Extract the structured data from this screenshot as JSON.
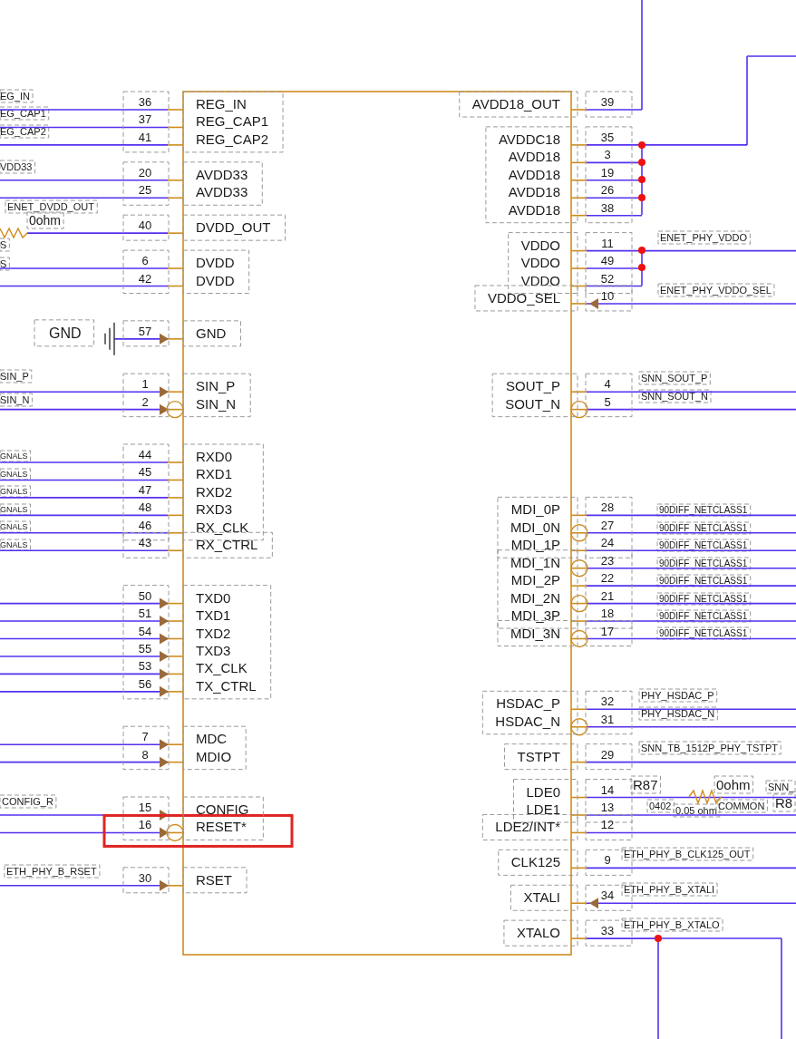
{
  "component": {
    "left_groups": [
      {
        "pins": [
          {
            "number": "36",
            "name": "REG_IN",
            "kind": "line",
            "highlighted": false
          },
          {
            "number": "37",
            "name": "REG_CAP1",
            "kind": "line",
            "highlighted": false
          },
          {
            "number": "41",
            "name": "REG_CAP2",
            "kind": "line",
            "highlighted": false
          }
        ]
      },
      {
        "pins": [
          {
            "number": "20",
            "name": "AVDD33",
            "kind": "line",
            "highlighted": false
          },
          {
            "number": "25",
            "name": "AVDD33",
            "kind": "line",
            "highlighted": false
          }
        ]
      },
      {
        "pins": [
          {
            "number": "40",
            "name": "DVDD_OUT",
            "kind": "line",
            "highlighted": false
          }
        ]
      },
      {
        "pins": [
          {
            "number": "6",
            "name": "DVDD",
            "kind": "line",
            "highlighted": false
          },
          {
            "number": "42",
            "name": "DVDD",
            "kind": "line",
            "highlighted": false
          }
        ]
      },
      {
        "pins": [
          {
            "number": "57",
            "name": "GND",
            "kind": "input",
            "highlighted": false
          }
        ]
      },
      {
        "pins": [
          {
            "number": "1",
            "name": "SIN_P",
            "kind": "input",
            "highlighted": false
          },
          {
            "number": "2",
            "name": "SIN_N",
            "kind": "input_low",
            "highlighted": false
          }
        ]
      },
      {
        "pins": [
          {
            "number": "44",
            "name": "RXD0",
            "kind": "line",
            "highlighted": false
          },
          {
            "number": "45",
            "name": "RXD1",
            "kind": "line",
            "highlighted": false
          },
          {
            "number": "47",
            "name": "RXD2",
            "kind": "line",
            "highlighted": false
          },
          {
            "number": "48",
            "name": "RXD3",
            "kind": "line",
            "highlighted": false
          },
          {
            "number": "46",
            "name": "RX_CLK",
            "kind": "line",
            "highlighted": false
          }
        ]
      },
      {
        "pins": [
          {
            "number": "43",
            "name": "RX_CTRL",
            "kind": "line",
            "highlighted": false
          }
        ]
      },
      {
        "pins": [
          {
            "number": "50",
            "name": "TXD0",
            "kind": "input",
            "highlighted": false
          },
          {
            "number": "51",
            "name": "TXD1",
            "kind": "input",
            "highlighted": false
          },
          {
            "number": "54",
            "name": "TXD2",
            "kind": "input",
            "highlighted": false
          },
          {
            "number": "55",
            "name": "TXD3",
            "kind": "input",
            "highlighted": false
          },
          {
            "number": "53",
            "name": "TX_CLK",
            "kind": "input",
            "highlighted": false
          },
          {
            "number": "56",
            "name": "TX_CTRL",
            "kind": "input",
            "highlighted": false
          }
        ]
      },
      {
        "pins": [
          {
            "number": "7",
            "name": "MDC",
            "kind": "input",
            "highlighted": false
          },
          {
            "number": "8",
            "name": "MDIO",
            "kind": "input",
            "highlighted": false
          }
        ]
      },
      {
        "pins": [
          {
            "number": "15",
            "name": "CONFIG",
            "kind": "input",
            "highlighted": false
          },
          {
            "number": "16",
            "name": "RESET*",
            "kind": "input_low",
            "highlighted": true
          }
        ]
      },
      {
        "pins": [
          {
            "number": "30",
            "name": "RSET",
            "kind": "input",
            "highlighted": false
          }
        ]
      }
    ],
    "right_groups": [
      {
        "pins": [
          {
            "number": "39",
            "name": "AVDD18_OUT",
            "kind": "line",
            "highlighted": false
          }
        ]
      },
      {
        "pins": [
          {
            "number": "35",
            "name": "AVDDC18",
            "kind": "line",
            "highlighted": false
          },
          {
            "number": "3",
            "name": "AVDD18",
            "kind": "line",
            "highlighted": false
          },
          {
            "number": "19",
            "name": "AVDD18",
            "kind": "line",
            "highlighted": false
          },
          {
            "number": "26",
            "name": "AVDD18",
            "kind": "line",
            "highlighted": false
          },
          {
            "number": "38",
            "name": "AVDD18",
            "kind": "line",
            "highlighted": false
          }
        ]
      },
      {
        "pins": [
          {
            "number": "11",
            "name": "VDDO",
            "kind": "line",
            "highlighted": false
          },
          {
            "number": "49",
            "name": "VDDO",
            "kind": "line",
            "highlighted": false
          },
          {
            "number": "52",
            "name": "VDDO",
            "kind": "line",
            "highlighted": false
          }
        ]
      },
      {
        "pins": [
          {
            "number": "10",
            "name": "VDDO_SEL",
            "kind": "input",
            "highlighted": false
          }
        ]
      },
      {
        "pins": [
          {
            "number": "4",
            "name": "SOUT_P",
            "kind": "line",
            "highlighted": false
          },
          {
            "number": "5",
            "name": "SOUT_N",
            "kind": "low",
            "highlighted": false
          }
        ]
      },
      {
        "pins": [
          {
            "number": "28",
            "name": "MDI_0P",
            "kind": "line",
            "highlighted": false
          },
          {
            "number": "27",
            "name": "MDI_0N",
            "kind": "low",
            "highlighted": false
          },
          {
            "number": "24",
            "name": "MDI_1P",
            "kind": "line",
            "highlighted": false
          }
        ]
      },
      {
        "pins": [
          {
            "number": "23",
            "name": "MDI_1N",
            "kind": "low",
            "highlighted": false
          },
          {
            "number": "22",
            "name": "MDI_2P",
            "kind": "line",
            "highlighted": false
          },
          {
            "number": "21",
            "name": "MDI_2N",
            "kind": "low",
            "highlighted": false
          },
          {
            "number": "18",
            "name": "MDI_3P",
            "kind": "line",
            "highlighted": false
          }
        ]
      },
      {
        "pins": [
          {
            "number": "17",
            "name": "MDI_3N",
            "kind": "low",
            "highlighted": false
          }
        ]
      },
      {
        "pins": [
          {
            "number": "32",
            "name": "HSDAC_P",
            "kind": "line",
            "highlighted": false
          },
          {
            "number": "31",
            "name": "HSDAC_N",
            "kind": "low",
            "highlighted": false
          }
        ]
      },
      {
        "pins": [
          {
            "number": "29",
            "name": "TSTPT",
            "kind": "line",
            "highlighted": false
          }
        ]
      },
      {
        "pins": [
          {
            "number": "14",
            "name": "LDE0",
            "kind": "line",
            "highlighted": false
          },
          {
            "number": "13",
            "name": "LDE1",
            "kind": "line",
            "highlighted": false
          }
        ]
      },
      {
        "pins": [
          {
            "number": "12",
            "name": "LDE2/INT*",
            "kind": "line",
            "highlighted": false
          }
        ]
      },
      {
        "pins": [
          {
            "number": "9",
            "name": "CLK125",
            "kind": "line",
            "highlighted": false
          }
        ]
      },
      {
        "pins": [
          {
            "number": "34",
            "name": "XTALI",
            "kind": "input",
            "highlighted": false
          }
        ]
      },
      {
        "pins": [
          {
            "number": "33",
            "name": "XTALO",
            "kind": "line",
            "highlighted": false
          }
        ]
      }
    ]
  },
  "ground_label": "GND",
  "net_labels": [
    {
      "text": "EG_IN"
    },
    {
      "text": "EG_CAP1"
    },
    {
      "text": "EG_CAP2"
    },
    {
      "text": "VDD33"
    },
    {
      "text": "ENET_DVDD_OUT"
    },
    {
      "text": "0ohm"
    },
    {
      "text": "S"
    },
    {
      "text": "S"
    },
    {
      "text": "SIN_P"
    },
    {
      "text": "SIN_N"
    },
    {
      "text": "GNALS"
    },
    {
      "text": "GNALS"
    },
    {
      "text": "GNALS"
    },
    {
      "text": "GNALS"
    },
    {
      "text": "GNALS"
    },
    {
      "text": "GNALS"
    },
    {
      "text": "CONFIG_R"
    },
    {
      "text": "ETH_PHY_B_RSET"
    },
    {
      "text": "ENET_PHY_VDDO"
    },
    {
      "text": "ENET_PHY_VDDO_SEL"
    },
    {
      "text": "SNN_SOUT_P"
    },
    {
      "text": "SNN_SOUT_N"
    },
    {
      "text": "90DIFF_NETCLASS1"
    },
    {
      "text": "90DIFF_NETCLASS1"
    },
    {
      "text": "90DIFF_NETCLASS1"
    },
    {
      "text": "90DIFF_NETCLASS1"
    },
    {
      "text": "90DIFF_NETCLASS1"
    },
    {
      "text": "90DIFF_NETCLASS1"
    },
    {
      "text": "90DIFF_NETCLASS1"
    },
    {
      "text": "90DIFF_NETCLASS1"
    },
    {
      "text": "PHY_HSDAC_P"
    },
    {
      "text": "PHY_HSDAC_N"
    },
    {
      "text": "SNN_TB_1512P_PHY_TSTPT"
    },
    {
      "text": "R87"
    },
    {
      "text": "0ohm"
    },
    {
      "text": "SNN_"
    },
    {
      "text": "0402"
    },
    {
      "text": "0.05 ohm"
    },
    {
      "text": "COMMON"
    },
    {
      "text": "R8"
    },
    {
      "text": "ETH_PHY_B_CLK125_OUT"
    },
    {
      "text": "ETH_PHY_B_XTALI"
    },
    {
      "text": "ETH_PHY_B_XTALO"
    }
  ]
}
